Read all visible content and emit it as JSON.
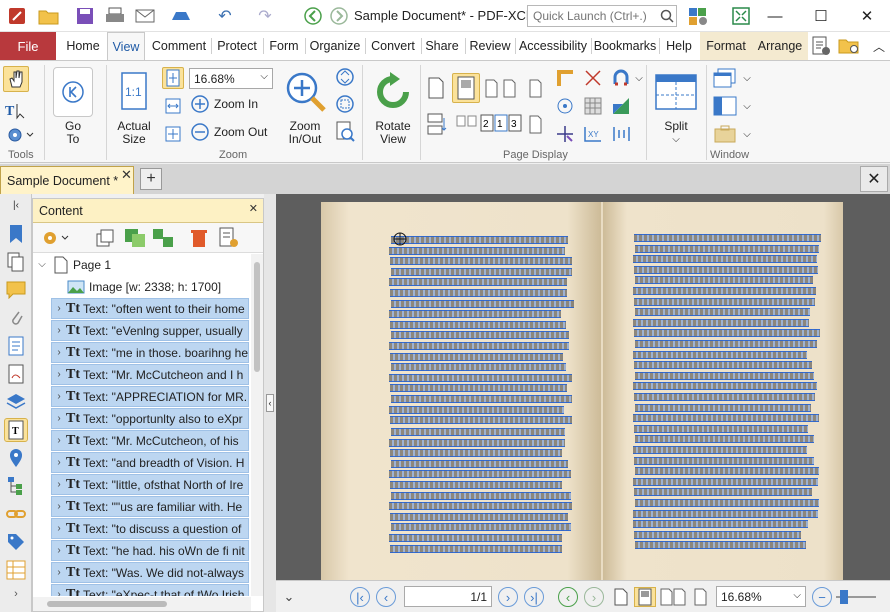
{
  "titlebar": {
    "title": "Sample Document* - PDF-XCh...",
    "quick_launch_placeholder": "Quick Launch (Ctrl+.)"
  },
  "tabs": {
    "file": "File",
    "items": [
      "Home",
      "View",
      "Comment",
      "Protect",
      "Form",
      "Organize",
      "Convert",
      "Share",
      "Review",
      "Accessibility",
      "Bookmarks",
      "Help",
      "Format",
      "Arrange"
    ],
    "selected": "View"
  },
  "ribbon": {
    "tools_label": "Tools",
    "goto_label": "Go",
    "goto_label2": "To",
    "actual_size_label": "Actual",
    "actual_size_label2": "Size",
    "zoom_value": "16.68%",
    "zoom_in_label": "Zoom In",
    "zoom_out_label": "Zoom Out",
    "zoom_inout_label": "Zoom",
    "zoom_inout_label2": "In/Out",
    "zoom_group_label": "Zoom",
    "rotate_label": "Rotate",
    "rotate_label2": "View",
    "page_display_label": "Page Display",
    "split_label": "Split",
    "window_label": "Window"
  },
  "doctab": {
    "name": "Sample Document *"
  },
  "panel": {
    "title": "Content",
    "tree": [
      {
        "label": "Page 1",
        "type": "page"
      },
      {
        "label": "Image [w: 2338; h: 1700]",
        "type": "image"
      },
      {
        "label": "Text: \"often went to their home",
        "type": "text"
      },
      {
        "label": "Text: \"eVenlng supper, usually",
        "type": "text"
      },
      {
        "label": "Text: \"me in those. boarihng he",
        "type": "text"
      },
      {
        "label": "Text: \"Mr. McCutcheon and I h",
        "type": "text"
      },
      {
        "label": "Text: \"APPRECIATION for MR. M",
        "type": "text"
      },
      {
        "label": "Text: \"opportunlty also to eXpr",
        "type": "text"
      },
      {
        "label": "Text: \"Mr. McCutcheon, of his",
        "type": "text"
      },
      {
        "label": "Text: \"and breadth of Vision. H",
        "type": "text"
      },
      {
        "label": "Text: \"little, ofsthat North of Ire",
        "type": "text"
      },
      {
        "label": "Text: \"\"us are familiar with. He",
        "type": "text"
      },
      {
        "label": "Text: \"to discuss a question of",
        "type": "text"
      },
      {
        "label": "Text: \"he had. his oWn de fi nit",
        "type": "text"
      },
      {
        "label": "Text: \"Was. We did not-always",
        "type": "text"
      },
      {
        "label": "Text: \"eXpec-t that of tWo Irish",
        "type": "text"
      }
    ],
    "text_prefix": "Tt"
  },
  "statusbar": {
    "page": "1/1",
    "zoom": "16.68%"
  },
  "colors": {
    "file_tab": "#b8393d",
    "accent": "#1f5aa6",
    "highlight": "#bcd6f1",
    "doc_tab": "#fff3c9",
    "paper": "#eee2ca"
  }
}
